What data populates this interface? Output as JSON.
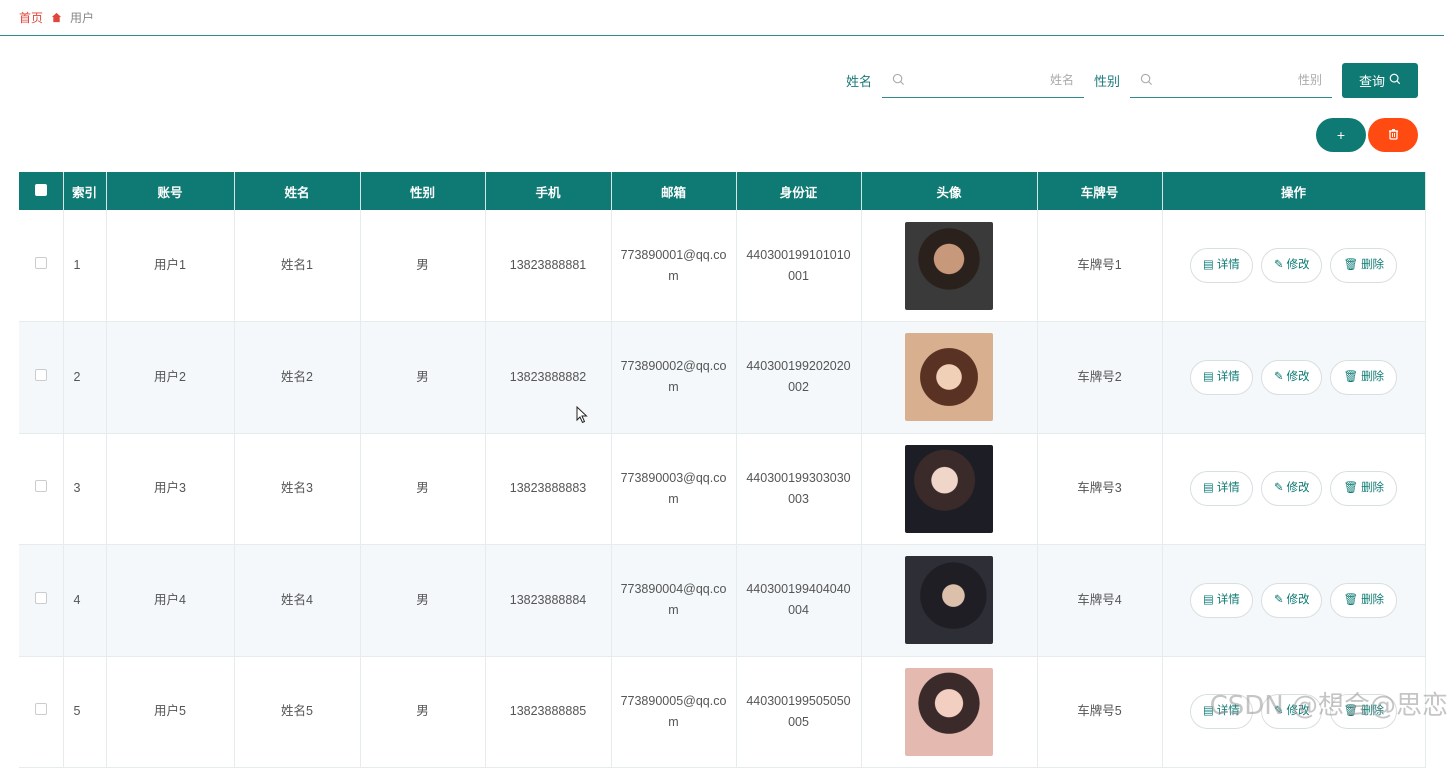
{
  "breadcrumb": {
    "home": "首页",
    "current": "用户"
  },
  "search": {
    "name_label": "姓名",
    "name_placeholder": "姓名",
    "gender_label": "性别",
    "gender_placeholder": "性别",
    "query_label": "查询"
  },
  "actions": {
    "add_label": "+"
  },
  "table": {
    "headers": [
      "索引",
      "账号",
      "姓名",
      "性别",
      "手机",
      "邮箱",
      "身份证",
      "头像",
      "车牌号",
      "操作"
    ],
    "rows": [
      {
        "index": "1",
        "account": "用户1",
        "name": "姓名1",
        "gender": "男",
        "phone": "13823888881",
        "email": "773890001@qq.com",
        "id_card": "440300199101010001",
        "plate": "车牌号1"
      },
      {
        "index": "2",
        "account": "用户2",
        "name": "姓名2",
        "gender": "男",
        "phone": "13823888882",
        "email": "773890002@qq.com",
        "id_card": "440300199202020002",
        "plate": "车牌号2"
      },
      {
        "index": "3",
        "account": "用户3",
        "name": "姓名3",
        "gender": "男",
        "phone": "13823888883",
        "email": "773890003@qq.com",
        "id_card": "440300199303030003",
        "plate": "车牌号3"
      },
      {
        "index": "4",
        "account": "用户4",
        "name": "姓名4",
        "gender": "男",
        "phone": "13823888884",
        "email": "773890004@qq.com",
        "id_card": "440300199404040004",
        "plate": "车牌号4"
      },
      {
        "index": "5",
        "account": "用户5",
        "name": "姓名5",
        "gender": "男",
        "phone": "13823888885",
        "email": "773890005@qq.com",
        "id_card": "440300199505050005",
        "plate": "车牌号5"
      }
    ],
    "row_actions": {
      "detail": "详情",
      "edit": "修改",
      "delete": "删除"
    }
  },
  "watermark": "CSDN @想会@思恋",
  "colors": {
    "primary": "#0e7a73",
    "danger": "#ff4a12",
    "breadcrumb_home": "#e0473a"
  }
}
